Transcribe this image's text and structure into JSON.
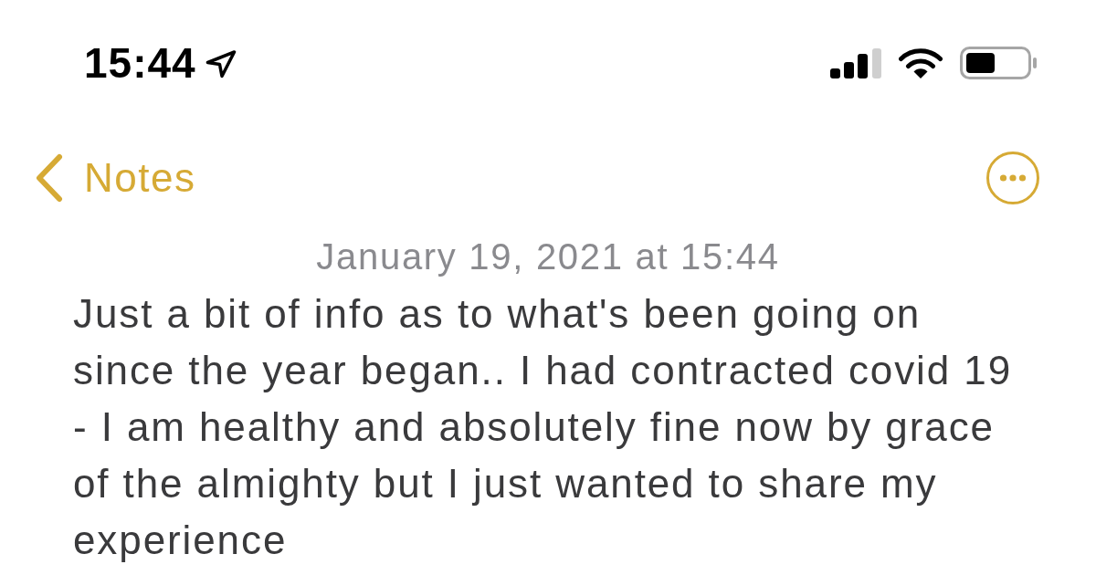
{
  "status_bar": {
    "time": "15:44"
  },
  "nav_bar": {
    "back_label": "Notes"
  },
  "note": {
    "date": "January 19, 2021 at 15:44",
    "body": "Just a bit of info as to what's been going on since the year began.. I had contracted covid 19 - I am healthy and absolutely fine now by grace of the almighty but I just wanted to share my experience"
  }
}
